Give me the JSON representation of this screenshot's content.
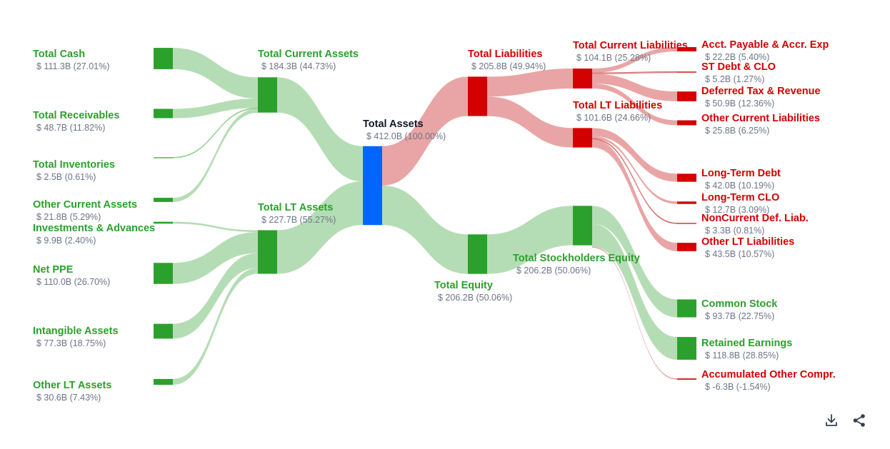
{
  "chart_data": {
    "type": "sankey",
    "unit_prefix": "$",
    "colors": {
      "asset": "#2ca02c",
      "asset_link": "#b1dbb1",
      "liability": "#d40000",
      "liability_link": "#e8a0a0",
      "total": "#0066ff",
      "value_text": "#6e7488",
      "total_label": "#111827"
    },
    "nodes": [
      {
        "id": "total_cash",
        "name": "Total Cash",
        "value_text": "$ 111.3B (27.01%)",
        "value": 111.3,
        "group": "asset"
      },
      {
        "id": "total_receivables",
        "name": "Total Receivables",
        "value_text": "$ 48.7B (11.82%)",
        "value": 48.7,
        "group": "asset"
      },
      {
        "id": "total_inventories",
        "name": "Total Inventories",
        "value_text": "$ 2.5B (0.61%)",
        "value": 2.5,
        "group": "asset"
      },
      {
        "id": "other_current_assets",
        "name": "Other Current Assets",
        "value_text": "$ 21.8B (5.29%)",
        "value": 21.8,
        "group": "asset"
      },
      {
        "id": "investments_advances",
        "name": "Investments & Advances",
        "value_text": "$ 9.9B (2.40%)",
        "value": 9.9,
        "group": "asset"
      },
      {
        "id": "net_ppe",
        "name": "Net PPE",
        "value_text": "$ 110.0B (26.70%)",
        "value": 110.0,
        "group": "asset"
      },
      {
        "id": "intangible_assets",
        "name": "Intangible Assets",
        "value_text": "$ 77.3B (18.75%)",
        "value": 77.3,
        "group": "asset"
      },
      {
        "id": "other_lt_assets",
        "name": "Other LT Assets",
        "value_text": "$ 30.6B (7.43%)",
        "value": 30.6,
        "group": "asset"
      },
      {
        "id": "total_current_assets",
        "name": "Total Current Assets",
        "value_text": "$ 184.3B (44.73%)",
        "value": 184.3,
        "group": "asset"
      },
      {
        "id": "total_lt_assets",
        "name": "Total LT Assets",
        "value_text": "$ 227.7B (55.27%)",
        "value": 227.7,
        "group": "asset"
      },
      {
        "id": "total_assets",
        "name": "Total Assets",
        "value_text": "$ 412.0B (100.00%)",
        "value": 412.0,
        "group": "total"
      },
      {
        "id": "total_liabilities",
        "name": "Total Liabilities",
        "value_text": "$ 205.8B (49.94%)",
        "value": 205.8,
        "group": "liability"
      },
      {
        "id": "total_equity",
        "name": "Total Equity",
        "value_text": "$ 206.2B (50.06%)",
        "value": 206.2,
        "group": "asset"
      },
      {
        "id": "total_current_liabilities",
        "name": "Total Current Liabilities",
        "value_text": "$ 104.1B (25.28%)",
        "value": 104.1,
        "group": "liability"
      },
      {
        "id": "total_lt_liabilities",
        "name": "Total LT Liabilities",
        "value_text": "$ 101.6B (24.66%)",
        "value": 101.6,
        "group": "liability"
      },
      {
        "id": "total_stockholders_equity",
        "name": "Total Stockholders Equity",
        "value_text": "$ 206.2B (50.06%)",
        "value": 206.2,
        "group": "asset"
      },
      {
        "id": "acct_payable",
        "name": "Acct. Payable & Accr. Exp",
        "value_text": "$ 22.2B (5.40%)",
        "value": 22.2,
        "group": "liability"
      },
      {
        "id": "st_debt_clo",
        "name": "ST Debt & CLO",
        "value_text": "$ 5.2B (1.27%)",
        "value": 5.2,
        "group": "liability"
      },
      {
        "id": "deferred_tax_revenue",
        "name": "Deferred Tax & Revenue",
        "value_text": "$ 50.9B (12.36%)",
        "value": 50.9,
        "group": "liability"
      },
      {
        "id": "other_current_liabilities",
        "name": "Other Current Liabilities",
        "value_text": "$ 25.8B (6.25%)",
        "value": 25.8,
        "group": "liability"
      },
      {
        "id": "long_term_debt",
        "name": "Long-Term Debt",
        "value_text": "$ 42.0B (10.19%)",
        "value": 42.0,
        "group": "liability"
      },
      {
        "id": "long_term_clo",
        "name": "Long-Term CLO",
        "value_text": "$ 12.7B (3.09%)",
        "value": 12.7,
        "group": "liability"
      },
      {
        "id": "noncurrent_def_liab",
        "name": "NonCurrent Def. Liab.",
        "value_text": "$ 3.3B (0.81%)",
        "value": 3.3,
        "group": "liability"
      },
      {
        "id": "other_lt_liabilities",
        "name": "Other LT Liabilities",
        "value_text": "$ 43.5B (10.57%)",
        "value": 43.5,
        "group": "liability"
      },
      {
        "id": "common_stock",
        "name": "Common Stock",
        "value_text": "$ 93.7B (22.75%)",
        "value": 93.7,
        "group": "asset"
      },
      {
        "id": "retained_earnings",
        "name": "Retained Earnings",
        "value_text": "$ 118.8B (28.85%)",
        "value": 118.8,
        "group": "asset"
      },
      {
        "id": "accumulated_other_compr",
        "name": "Accumulated Other Compr.",
        "value_text": "$ -6.3B (-1.54%)",
        "value": -6.3,
        "group": "liability"
      }
    ],
    "links": [
      {
        "source": "total_cash",
        "target": "total_current_assets",
        "value": 111.3
      },
      {
        "source": "total_receivables",
        "target": "total_current_assets",
        "value": 48.7
      },
      {
        "source": "total_inventories",
        "target": "total_current_assets",
        "value": 2.5
      },
      {
        "source": "other_current_assets",
        "target": "total_current_assets",
        "value": 21.8
      },
      {
        "source": "investments_advances",
        "target": "total_lt_assets",
        "value": 9.9
      },
      {
        "source": "net_ppe",
        "target": "total_lt_assets",
        "value": 110.0
      },
      {
        "source": "intangible_assets",
        "target": "total_lt_assets",
        "value": 77.3
      },
      {
        "source": "other_lt_assets",
        "target": "total_lt_assets",
        "value": 30.6
      },
      {
        "source": "total_current_assets",
        "target": "total_assets",
        "value": 184.3
      },
      {
        "source": "total_lt_assets",
        "target": "total_assets",
        "value": 227.7
      },
      {
        "source": "total_assets",
        "target": "total_liabilities",
        "value": 205.8
      },
      {
        "source": "total_assets",
        "target": "total_equity",
        "value": 206.2
      },
      {
        "source": "total_liabilities",
        "target": "total_current_liabilities",
        "value": 104.1
      },
      {
        "source": "total_liabilities",
        "target": "total_lt_liabilities",
        "value": 101.6
      },
      {
        "source": "total_equity",
        "target": "total_stockholders_equity",
        "value": 206.2
      },
      {
        "source": "total_current_liabilities",
        "target": "acct_payable",
        "value": 22.2
      },
      {
        "source": "total_current_liabilities",
        "target": "st_debt_clo",
        "value": 5.2
      },
      {
        "source": "total_current_liabilities",
        "target": "deferred_tax_revenue",
        "value": 50.9
      },
      {
        "source": "total_current_liabilities",
        "target": "other_current_liabilities",
        "value": 25.8
      },
      {
        "source": "total_lt_liabilities",
        "target": "long_term_debt",
        "value": 42.0
      },
      {
        "source": "total_lt_liabilities",
        "target": "long_term_clo",
        "value": 12.7
      },
      {
        "source": "total_lt_liabilities",
        "target": "noncurrent_def_liab",
        "value": 3.3
      },
      {
        "source": "total_lt_liabilities",
        "target": "other_lt_liabilities",
        "value": 43.5
      },
      {
        "source": "total_stockholders_equity",
        "target": "common_stock",
        "value": 93.7
      },
      {
        "source": "total_stockholders_equity",
        "target": "retained_earnings",
        "value": 118.8
      },
      {
        "source": "total_stockholders_equity",
        "target": "accumulated_other_compr",
        "value": -6.3
      }
    ]
  },
  "toolbar": {
    "download_icon": "download-icon",
    "share_icon": "share-icon"
  }
}
